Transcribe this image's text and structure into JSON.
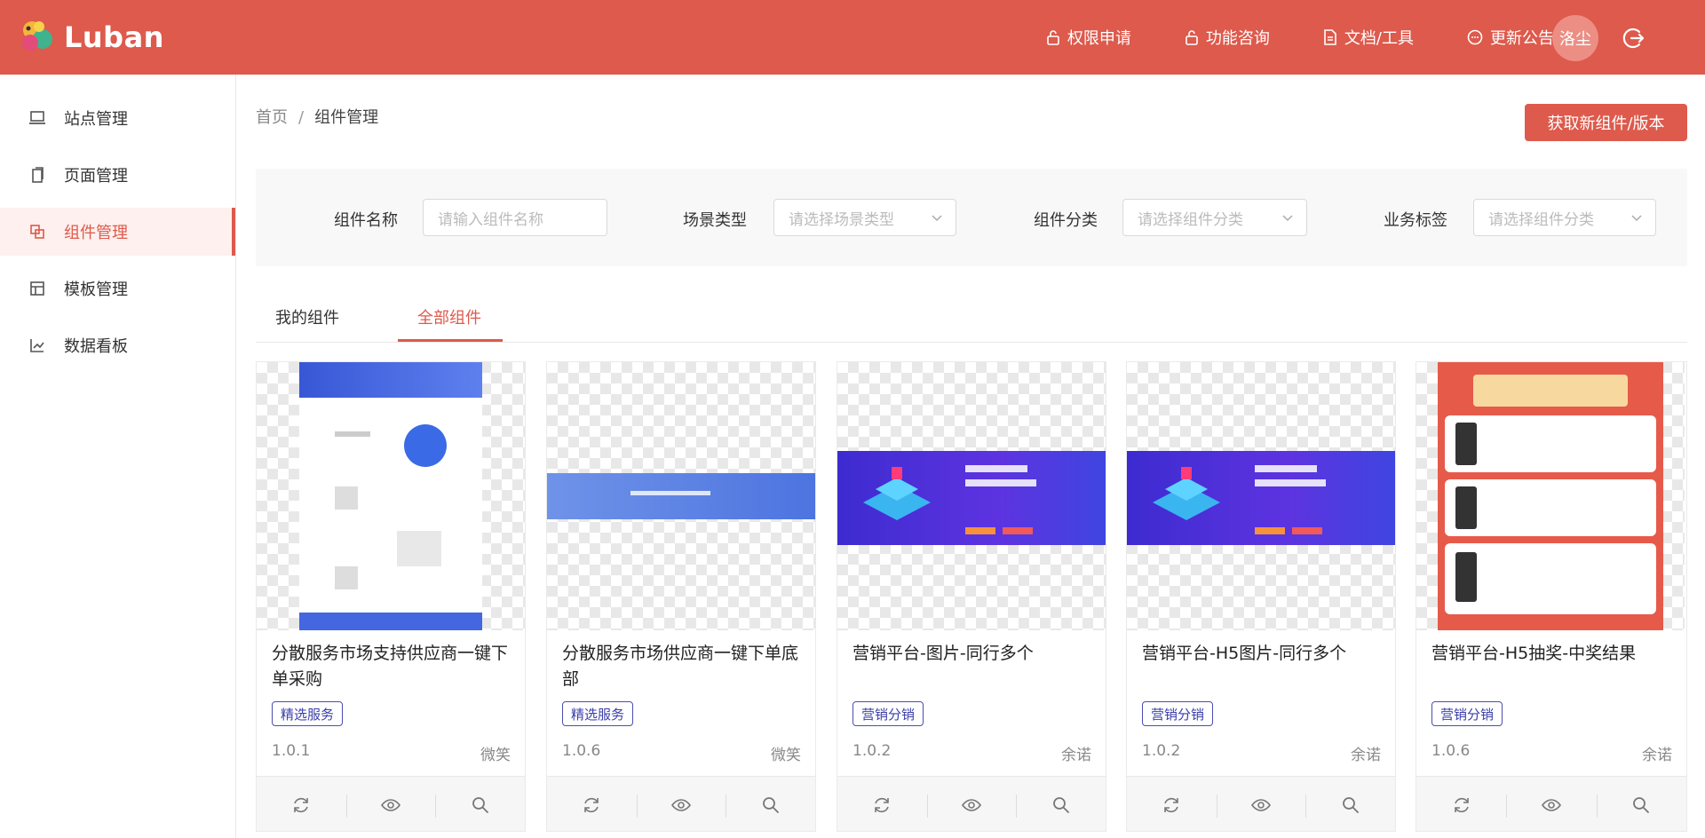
{
  "app": {
    "logo_text": "Luban"
  },
  "topnav": [
    {
      "label": "权限申请",
      "icon": "lock-icon"
    },
    {
      "label": "功能咨询",
      "icon": "lock-icon"
    },
    {
      "label": "文档/工具",
      "icon": "document-icon"
    },
    {
      "label": "更新公告",
      "icon": "chat-icon"
    }
  ],
  "user": {
    "avatar_text": "洛尘"
  },
  "sidebar": {
    "items": [
      {
        "label": "站点管理",
        "icon": "laptop-icon"
      },
      {
        "label": "页面管理",
        "icon": "pages-icon"
      },
      {
        "label": "组件管理",
        "icon": "component-icon",
        "active": true
      },
      {
        "label": "模板管理",
        "icon": "template-icon"
      },
      {
        "label": "数据看板",
        "icon": "chart-icon"
      }
    ]
  },
  "breadcrumb": {
    "home": "首页",
    "separator": "/",
    "current": "组件管理"
  },
  "primary_button": "获取新组件/版本",
  "filters": {
    "name": {
      "label": "组件名称",
      "placeholder": "请输入组件名称"
    },
    "scene": {
      "label": "场景类型",
      "placeholder": "请选择场景类型"
    },
    "category": {
      "label": "组件分类",
      "placeholder": "请选择组件分类"
    },
    "business": {
      "label": "业务标签",
      "placeholder": "请选择组件分类"
    }
  },
  "tabs": {
    "mine": "我的组件",
    "all": "全部组件",
    "active": "all"
  },
  "cards": [
    {
      "title": "分散服务市场支持供应商一键下单采购",
      "tag": "精选服务",
      "version": "1.0.1",
      "author": "微笑"
    },
    {
      "title": "分散服务市场供应商一键下单底部",
      "tag": "精选服务",
      "version": "1.0.6",
      "author": "微笑"
    },
    {
      "title": "营销平台-图片-同行多个",
      "tag": "营销分销",
      "version": "1.0.2",
      "author": "余诺"
    },
    {
      "title": "营销平台-H5图片-同行多个",
      "tag": "营销分销",
      "version": "1.0.2",
      "author": "余诺"
    },
    {
      "title": "营销平台-H5抽奖-中奖结果",
      "tag": "营销分销",
      "version": "1.0.6",
      "author": "余诺"
    }
  ],
  "colors": {
    "brand": "#dd5a4c",
    "tag": "#3a3ea8"
  }
}
